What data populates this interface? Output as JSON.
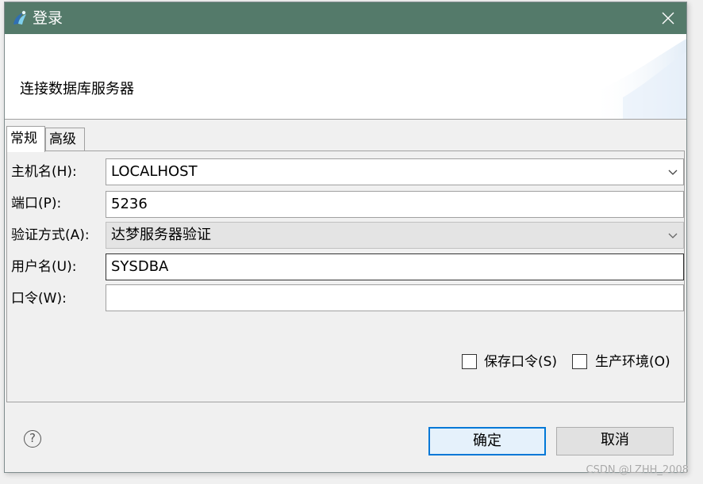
{
  "window": {
    "title": "登录",
    "close_glyph": "✕"
  },
  "banner": {
    "title": "连接数据库服务器"
  },
  "tabs": [
    {
      "label": "常规",
      "active": true
    },
    {
      "label": "高级",
      "active": false
    }
  ],
  "form": {
    "host": {
      "label": "主机名(H):",
      "value": "LOCALHOST"
    },
    "port": {
      "label": "端口(P):",
      "value": "5236"
    },
    "auth": {
      "label": "验证方式(A):",
      "value": "达梦服务器验证"
    },
    "user": {
      "label": "用户名(U):",
      "value": "SYSDBA"
    },
    "password": {
      "label": "口令(W):",
      "value": ""
    }
  },
  "options": {
    "save_password": {
      "label": "保存口令(S)",
      "checked": false
    },
    "production_env": {
      "label": "生产环境(O)",
      "checked": false
    }
  },
  "footer": {
    "help_glyph": "?",
    "ok_label": "确定",
    "cancel_label": "取消"
  },
  "watermark": "CSDN @LZHH_2008",
  "colors": {
    "titlebar": "#547a6a",
    "ok_border": "#0078d7"
  }
}
